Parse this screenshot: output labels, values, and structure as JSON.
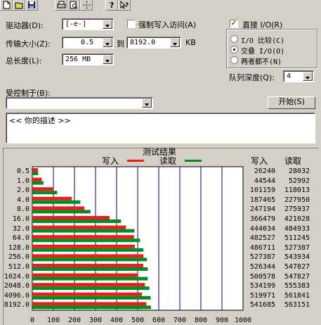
{
  "toolbar": {
    "buttons": [
      "new-icon",
      "open-icon",
      "save-icon",
      "print-icon",
      "print-preview-icon",
      "move-icon",
      "help-icon",
      "context-help-icon"
    ]
  },
  "settings": {
    "drive_label": "驱动器(D):",
    "drive_value": "[-e-]",
    "force_write_label": "强制写入访问(A)",
    "force_write_checked": false,
    "direct_io_label": "直接 I/O(R)",
    "direct_io_checked": true,
    "transfer_size_label": "传输大小(Z):",
    "transfer_min": "0.5",
    "to_label": "到",
    "transfer_max": "8192.0",
    "unit_kb": "KB",
    "total_length_label": "总长度(L):",
    "total_length_value": "256 MB",
    "overlap_options": [
      "I/O 比较(C)",
      "交叠 I/O(O)",
      "两者都不(N)"
    ],
    "overlap_selected": 1,
    "queue_depth_label": "队列深度(Q):",
    "queue_depth_value": "4",
    "controlled_by_label": "受控制于(B):",
    "controlled_by_value": "",
    "start_button": "开始(S)",
    "description_text": "<<  你的描述  >>"
  },
  "results": {
    "title": "测试结果",
    "write_legend": "写入",
    "read_legend": "读取",
    "col_write": "写入",
    "col_read": "读取",
    "write_color": "#e8201c",
    "read_color": "#0b8a22"
  },
  "chart_data": {
    "type": "bar",
    "orientation": "horizontal",
    "title": "测试结果",
    "categories": [
      "0.5",
      "1.0",
      "2.0",
      "4.0",
      "8.0",
      "16.0",
      "32.0",
      "64.0",
      "128.0",
      "256.0",
      "512.0",
      "1024.0",
      "2048.0",
      "4096.0",
      "8192.0"
    ],
    "series": [
      {
        "name": "写入",
        "values": [
          26240,
          44544,
          101159,
          187465,
          247194,
          366479,
          444034,
          482527,
          486711,
          527387,
          526344,
          500578,
          534199,
          519971,
          541685
        ]
      },
      {
        "name": "读取",
        "values": [
          28032,
          52992,
          118013,
          227950,
          275937,
          421028,
          484933,
          511245,
          527387,
          543934,
          547827,
          547827,
          555383,
          561841,
          563151
        ]
      }
    ],
    "xlim": [
      0,
      1000
    ],
    "xticks": [
      "0",
      "100",
      "200",
      "300",
      "400",
      "500",
      "600",
      "700",
      "800",
      "900",
      "1000"
    ],
    "grid": true,
    "legend_placement": "top"
  }
}
